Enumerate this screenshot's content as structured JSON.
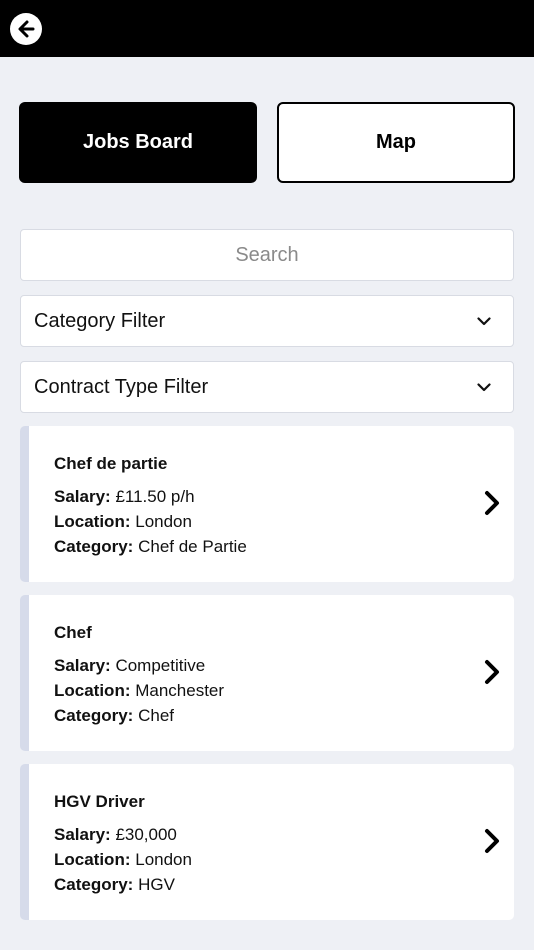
{
  "header": {
    "back_icon": "arrow-left-circle-icon"
  },
  "toggle": {
    "jobs_board_label": "Jobs Board",
    "map_label": "Map"
  },
  "search": {
    "placeholder": "Search",
    "value": ""
  },
  "filters": {
    "category_label": "Category Filter",
    "contract_type_label": "Contract Type Filter"
  },
  "labels": {
    "salary": "Salary:",
    "location": "Location:",
    "category": "Category:"
  },
  "jobs": [
    {
      "title": "Chef de partie",
      "salary": "£11.50 p/h",
      "location": "London",
      "category": "Chef de Partie"
    },
    {
      "title": "Chef",
      "salary": "Competitive",
      "location": "Manchester",
      "category": "Chef"
    },
    {
      "title": "HGV Driver",
      "salary": "£30,000",
      "location": "London",
      "category": "HGV"
    }
  ],
  "colors": {
    "background": "#eef0f5",
    "header": "#000000",
    "accent_bar": "#d6dbea"
  }
}
